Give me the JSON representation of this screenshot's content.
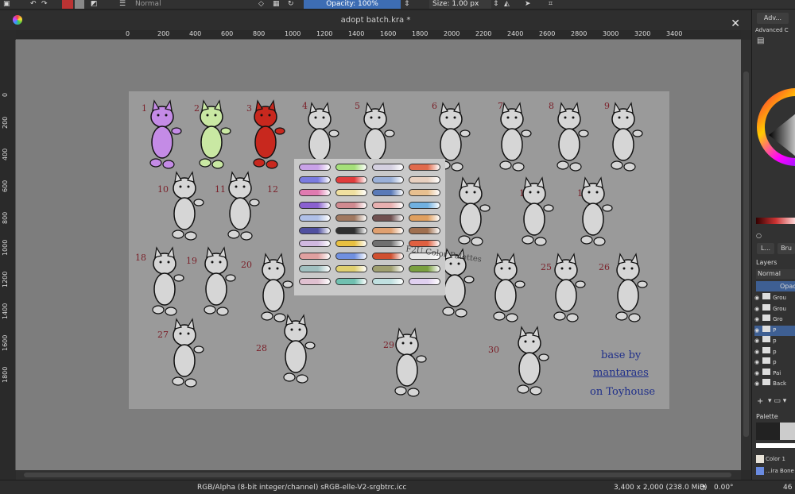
{
  "toolbar": {
    "blend_mode": "Normal",
    "opacity_label": "Opacity: 100%",
    "size_label": "Size: 1.00 px"
  },
  "document": {
    "title": "adopt batch.kra *"
  },
  "ruler": {
    "top": [
      "0",
      "200",
      "400",
      "600",
      "800",
      "1000",
      "1200",
      "1400",
      "1600",
      "1800",
      "2000",
      "2200",
      "2400",
      "2600",
      "2800",
      "3000",
      "3200",
      "3400"
    ],
    "left": [
      "0",
      "200",
      "400",
      "600",
      "800",
      "1000",
      "1200",
      "1400",
      "1600",
      "1800"
    ]
  },
  "artwork": {
    "numbers": [
      "1",
      "2",
      "3",
      "4",
      "5",
      "6",
      "7",
      "8",
      "9",
      "10",
      "11",
      "12",
      "14",
      "17",
      "18",
      "19",
      "20",
      "25",
      "26",
      "27",
      "28",
      "29",
      "30"
    ],
    "f2u_note": "F2U Color Palettes",
    "credit_line1": "base by",
    "credit_line2": "mantaraes",
    "credit_line3": "on Toyhouse"
  },
  "statusbar": {
    "color_space": "RGB/Alpha (8-bit integer/channel)  sRGB-elle-V2-srgbtrc.icc",
    "dimensions": "3,400 x 2,000 (238.0 MiB)",
    "rotation": "0.00°",
    "zoom": "46"
  },
  "dock": {
    "tab_adv": "Adv...",
    "advanced_color": "Advanced C",
    "tab_l": "L...",
    "tab_bru": "Bru",
    "layers_title": "Layers",
    "layers_blend": "Normal",
    "layers_opacity": "Opacit",
    "layers": [
      "Grou",
      "Grou",
      "Gro",
      "P",
      "p",
      "p",
      "p",
      "Pai",
      "Back"
    ],
    "palette_title": "Palette",
    "color1": "Color 1",
    "palette_name": "...ira Bone"
  },
  "colors": {
    "accent": "#3d6db4",
    "canvas_bg": "#7d7d7d",
    "artboard": "#9a9a9a",
    "number_ink": "#7a1f28",
    "credit_ink": "#1f2f8a"
  }
}
